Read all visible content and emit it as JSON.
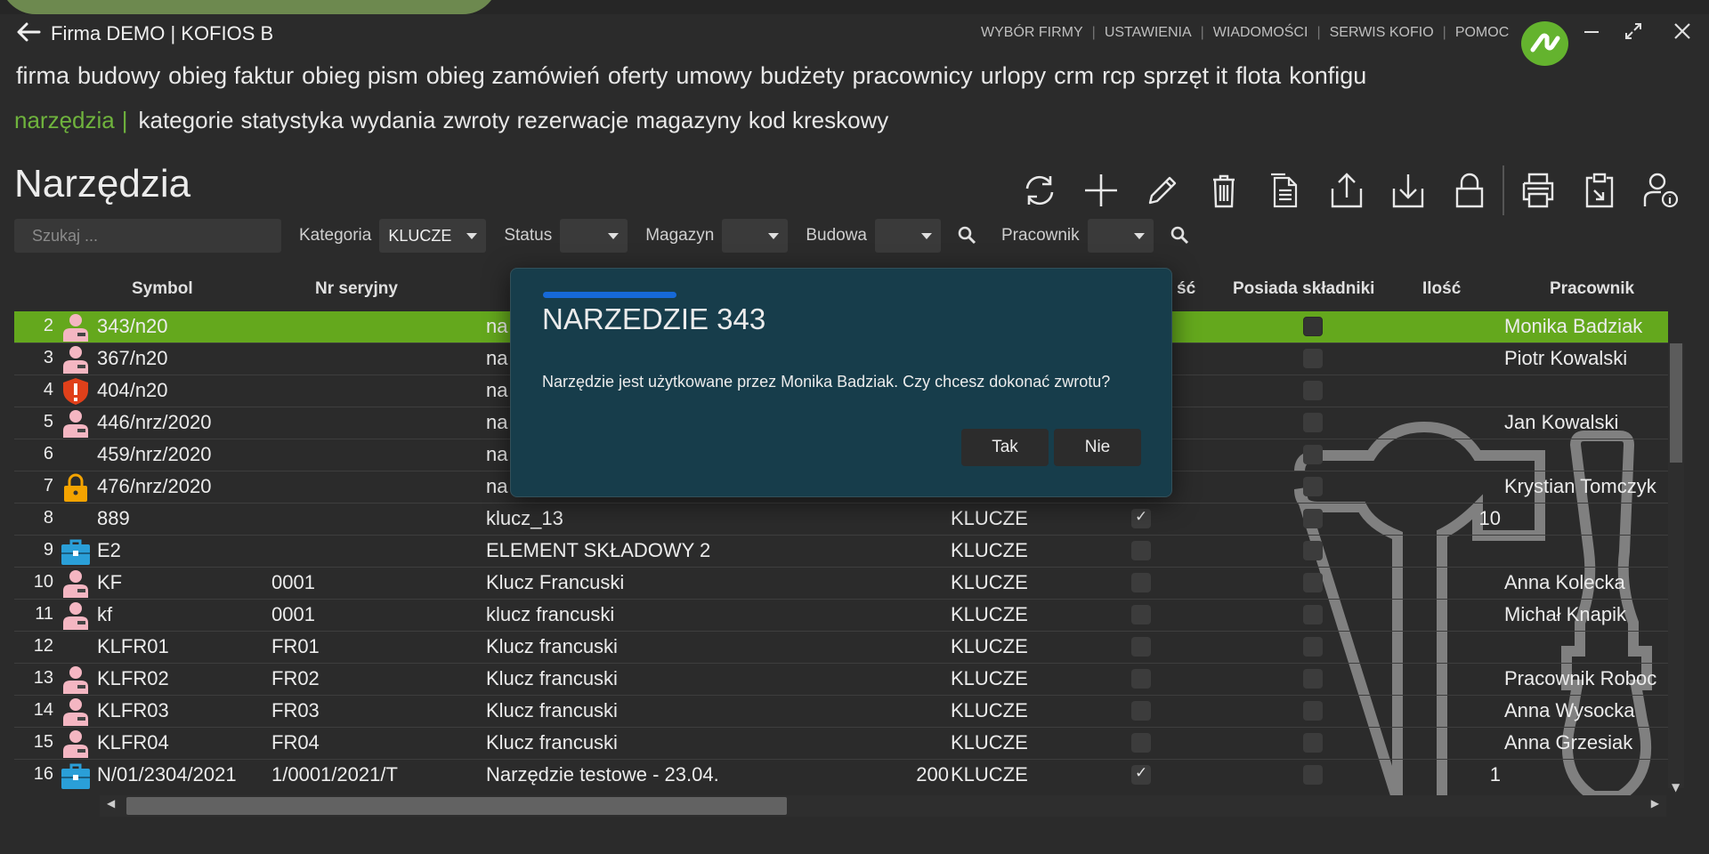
{
  "window": {
    "title": "Firma DEMO | KOFIOS B",
    "min_icon": "minimize-icon",
    "max_icon": "maximize-icon",
    "close_icon": "close-icon"
  },
  "top_menu": [
    "WYBÓR FIRMY",
    "USTAWIENIA",
    "WIADOMOŚCI",
    "SERWIS KOFIO",
    "POMOC"
  ],
  "modules": [
    "firma",
    "budowy",
    "obieg faktur",
    "obieg pism",
    "obieg zamówień",
    "oferty",
    "umowy",
    "budżety",
    "pracownicy",
    "urlopy",
    "crm",
    "rcp",
    "sprzęt it",
    "flota",
    "konfigu"
  ],
  "submodules": {
    "active": "narzędzia",
    "bar": "|",
    "items": [
      "kategorie",
      "statystyka",
      "wydania",
      "zwroty",
      "rezerwacje",
      "magazyny",
      "kod kreskowy"
    ]
  },
  "page": {
    "title": "Narzędzia"
  },
  "filters": {
    "search_placeholder": "Szukaj ...",
    "kategoria_label": "Kategoria",
    "kategoria_value": "KLUCZE",
    "status_label": "Status",
    "status_value": "",
    "magazyn_label": "Magazyn",
    "magazyn_value": "",
    "budowa_label": "Budowa",
    "budowa_value": "",
    "pracownik_label": "Pracownik",
    "pracownik_value": ""
  },
  "columns": {
    "symbol": "Symbol",
    "nr_seryjny": "Nr seryjny",
    "partial": "ść",
    "posiada": "Posiada składniki",
    "ilosc": "Ilość",
    "pracownik": "Pracownik"
  },
  "rows": [
    {
      "n": "2",
      "icon": "user-icon",
      "symbol": "343/n20",
      "serial": "",
      "name": "na",
      "price": "",
      "cat": "",
      "flag": false,
      "comp": false,
      "qty": "",
      "worker": "Monika Badziak"
    },
    {
      "n": "3",
      "icon": "user-icon",
      "symbol": "367/n20",
      "serial": "",
      "name": "na",
      "price": "",
      "cat": "",
      "flag": false,
      "comp": false,
      "qty": "",
      "worker": "Piotr  Kowalski"
    },
    {
      "n": "4",
      "icon": "warning-shield-icon",
      "symbol": "404/n20",
      "serial": "",
      "name": "na",
      "price": "",
      "cat": "",
      "flag": false,
      "comp": false,
      "qty": "",
      "worker": ""
    },
    {
      "n": "5",
      "icon": "user-icon",
      "symbol": "446/nrz/2020",
      "serial": "",
      "name": "na",
      "price": "",
      "cat": "",
      "flag": false,
      "comp": false,
      "qty": "",
      "worker": "Jan Kowalski"
    },
    {
      "n": "6",
      "icon": "",
      "symbol": "459/nrz/2020",
      "serial": "",
      "name": "na",
      "price": "",
      "cat": "",
      "flag": false,
      "comp": false,
      "qty": "",
      "worker": ""
    },
    {
      "n": "7",
      "icon": "lock-icon",
      "symbol": "476/nrz/2020",
      "serial": "",
      "name": "na",
      "price": "",
      "cat": "",
      "flag": false,
      "comp": false,
      "qty": "",
      "worker": "Krystian Tomczyk"
    },
    {
      "n": "8",
      "icon": "",
      "symbol": "889",
      "serial": "",
      "name": "klucz_13",
      "price": "",
      "cat": "KLUCZE",
      "flag": true,
      "comp": false,
      "qty": "10",
      "worker": ""
    },
    {
      "n": "9",
      "icon": "toolbox-icon",
      "symbol": "E2",
      "serial": "",
      "name": "ELEMENT SKŁADOWY 2",
      "price": "",
      "cat": "KLUCZE",
      "flag": false,
      "comp": false,
      "qty": "",
      "worker": ""
    },
    {
      "n": "10",
      "icon": "user-icon",
      "symbol": "KF",
      "serial": "0001",
      "name": "Klucz Francuski",
      "price": "",
      "cat": "KLUCZE",
      "flag": false,
      "comp": false,
      "qty": "",
      "worker": "Anna Kolecka"
    },
    {
      "n": "11",
      "icon": "user-icon",
      "symbol": "kf",
      "serial": "0001",
      "name": "klucz francuski",
      "price": "",
      "cat": "KLUCZE",
      "flag": false,
      "comp": false,
      "qty": "",
      "worker": "Michał Knapik"
    },
    {
      "n": "12",
      "icon": "",
      "symbol": "KLFR01",
      "serial": "FR01",
      "name": "Klucz francuski",
      "price": "",
      "cat": "KLUCZE",
      "flag": false,
      "comp": false,
      "qty": "",
      "worker": ""
    },
    {
      "n": "13",
      "icon": "user-icon",
      "symbol": "KLFR02",
      "serial": "FR02",
      "name": "Klucz francuski",
      "price": "",
      "cat": "KLUCZE",
      "flag": false,
      "comp": false,
      "qty": "",
      "worker": "Pracownik Roboc"
    },
    {
      "n": "14",
      "icon": "user-icon",
      "symbol": "KLFR03",
      "serial": "FR03",
      "name": "Klucz francuski",
      "price": "",
      "cat": "KLUCZE",
      "flag": false,
      "comp": false,
      "qty": "",
      "worker": "Anna Wysocka"
    },
    {
      "n": "15",
      "icon": "user-icon",
      "symbol": "KLFR04",
      "serial": "FR04",
      "name": "Klucz francuski",
      "price": "",
      "cat": "KLUCZE",
      "flag": false,
      "comp": false,
      "qty": "",
      "worker": "Anna Grzesiak"
    },
    {
      "n": "16",
      "icon": "toolbox-icon",
      "symbol": "N/01/2304/2021",
      "serial": "1/0001/2021/T",
      "name": "Narzędzie testowe - 23.04.",
      "price": "200",
      "cat": "KLUCZE",
      "flag": true,
      "comp": false,
      "qty": "1",
      "worker": ""
    }
  ],
  "dialog": {
    "title": "NARZEDZIE 343",
    "message": "Narzędzie jest użytkowane przez Monika Badziak. Czy chcesz dokonać zwrotu?",
    "yes": "Tak",
    "no": "Nie"
  },
  "colors": {
    "accent_green": "#64a81d",
    "dialog_bg": "#173d4b",
    "dialog_accent": "#1669d8",
    "user_icon": "#f4b6c2",
    "warning_icon": "#e0401a",
    "lock_icon": "#f4a300",
    "toolbox_icon": "#2a9fd8"
  }
}
